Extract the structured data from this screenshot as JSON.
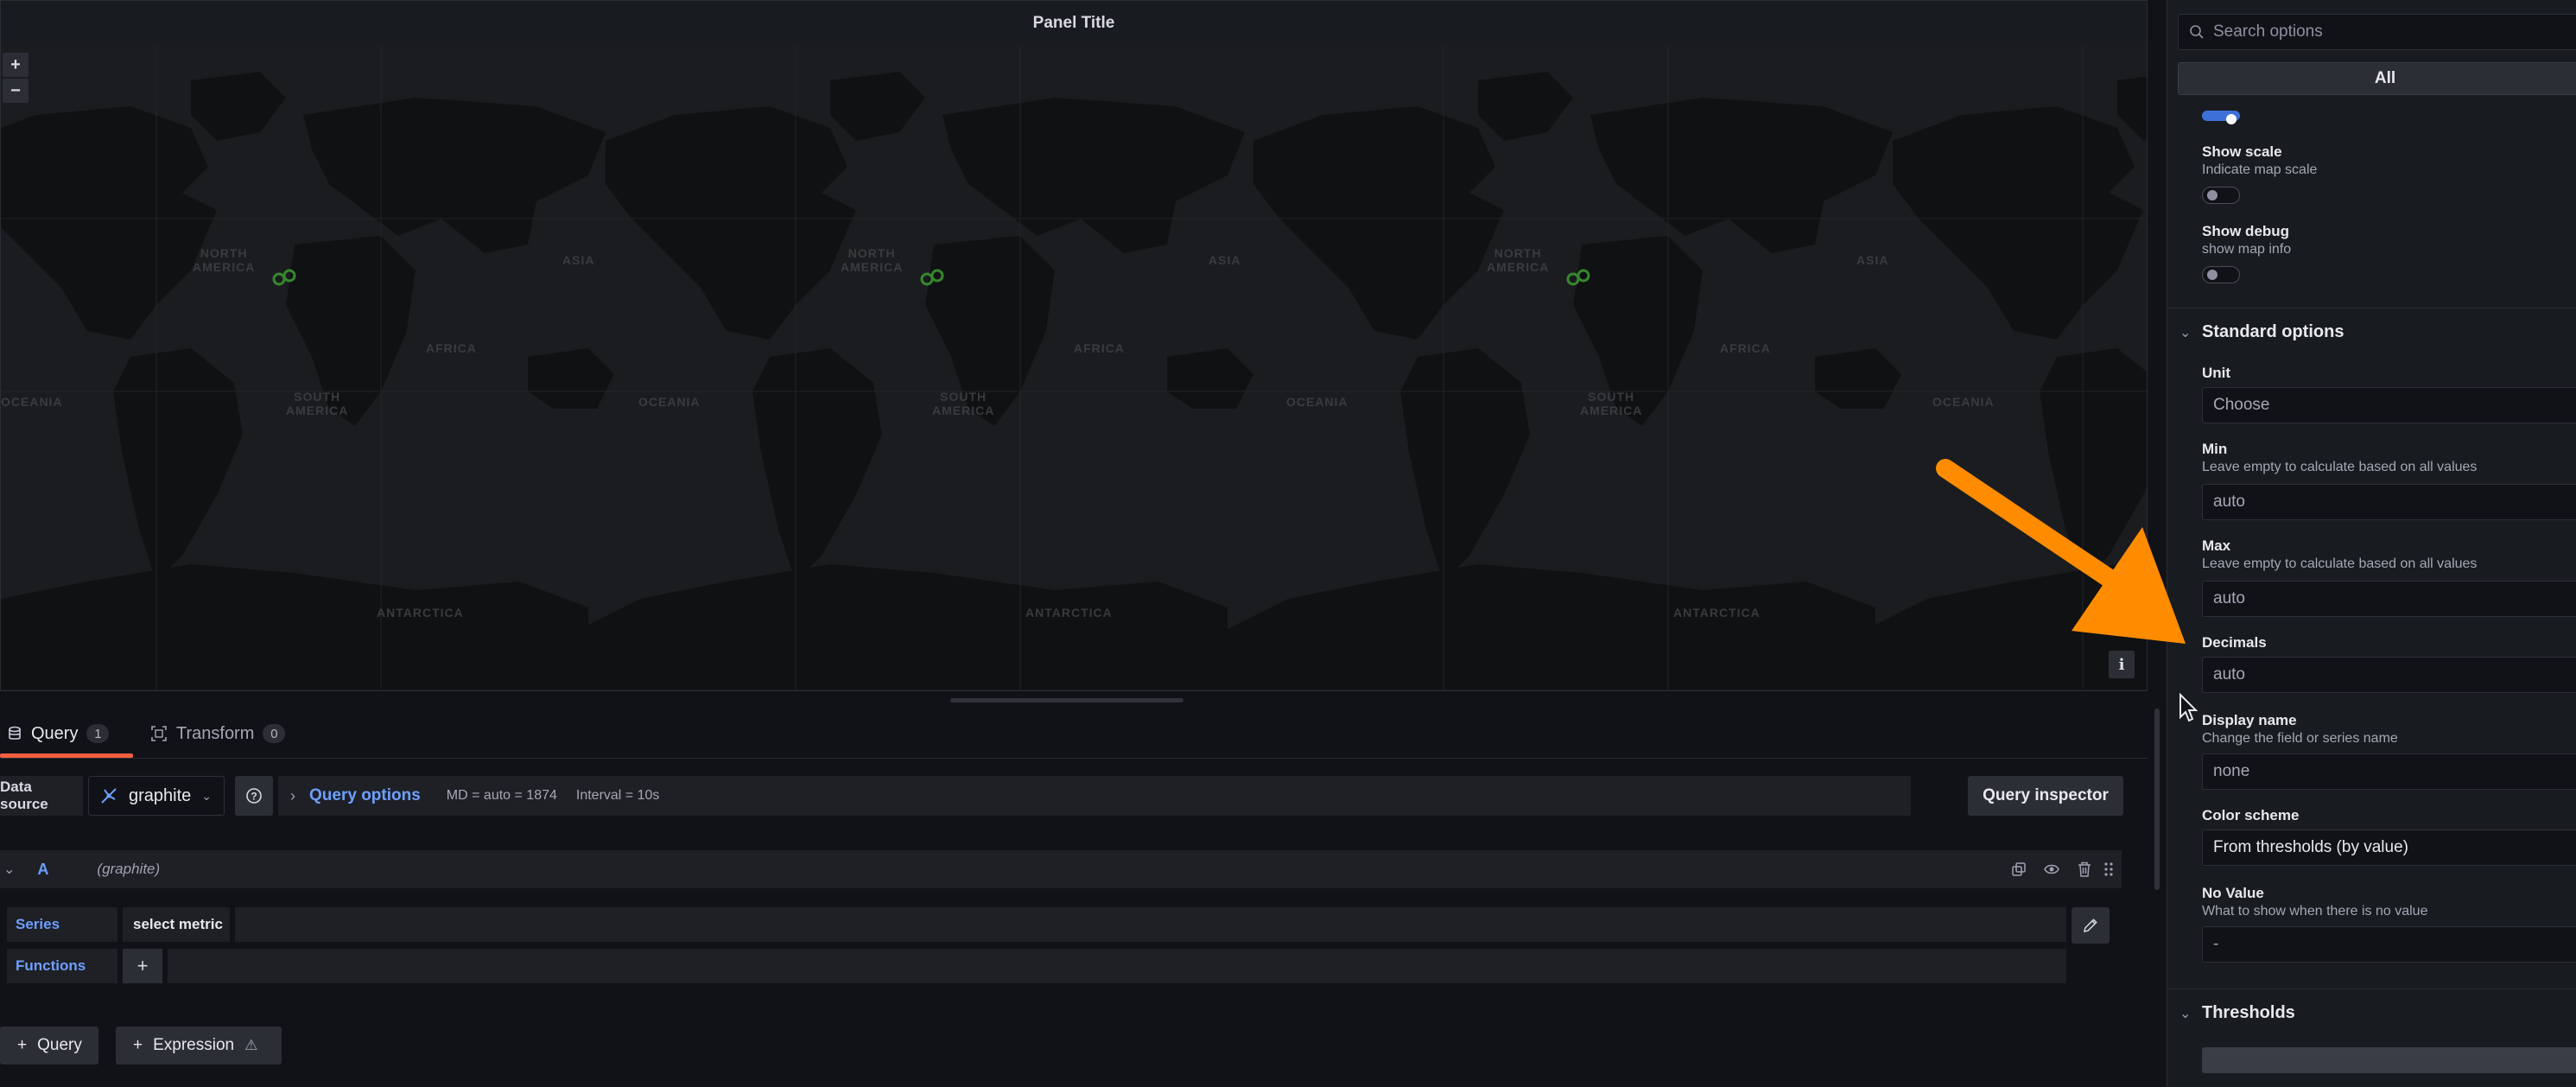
{
  "panel": {
    "title": "Panel Title",
    "zoom_in": "+",
    "zoom_out": "−",
    "info": "i",
    "map_labels": {
      "north_america": "NORTH\nAMERICA",
      "asia": "ASIA",
      "africa": "AFRICA",
      "south_america": "SOUTH\nAMERICA",
      "oceania": "OCEANIA",
      "oceania_cut": "OCEANIA",
      "antarctica": "ANTARCTICA"
    }
  },
  "editor": {
    "tabs": [
      {
        "label": "Query",
        "count": "1"
      },
      {
        "label": "Transform",
        "count": "0"
      }
    ],
    "data_source_label": "Data source",
    "data_source_value": "graphite",
    "query_options_label": "Query options",
    "md": "MD = auto = 1874",
    "interval": "Interval = 10s",
    "query_inspector": "Query inspector",
    "query": {
      "letter": "A",
      "datasource": "(graphite)",
      "series_key": "Series",
      "series_value": "select metric",
      "functions_key": "Functions",
      "functions_add": "+"
    },
    "add_query": "Query",
    "add_expression": "Expression"
  },
  "options": {
    "search_placeholder": "Search options",
    "filter_all": "All",
    "show_scale": {
      "label": "Show scale",
      "desc": "Indicate map scale"
    },
    "show_debug": {
      "label": "Show debug",
      "desc": "show map info"
    },
    "standard_options": "Standard options",
    "unit": {
      "label": "Unit",
      "value": "Choose"
    },
    "min": {
      "label": "Min",
      "desc": "Leave empty to calculate based on all values",
      "value": "auto"
    },
    "max": {
      "label": "Max",
      "desc": "Leave empty to calculate based on all values",
      "value": "auto"
    },
    "decimals": {
      "label": "Decimals",
      "value": "auto"
    },
    "display_name": {
      "label": "Display name",
      "desc": "Change the field or series name",
      "value": "none"
    },
    "color_scheme": {
      "label": "Color scheme",
      "value": "From thresholds (by value)"
    },
    "no_value": {
      "label": "No Value",
      "desc": "What to show when there is no value",
      "value": "-"
    },
    "thresholds": "Thresholds"
  },
  "colors": {
    "accent_blue": "#6e9fff",
    "tab_underline": "#f55f3e",
    "annotation_arrow": "#ff8c00",
    "marker_green": "#37872d"
  }
}
